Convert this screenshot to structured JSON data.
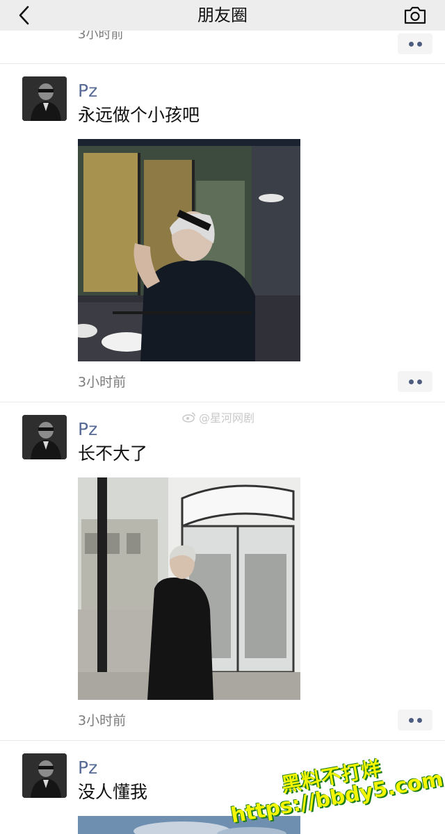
{
  "nav": {
    "title": "朋友圈",
    "back_icon": "chevron-left-icon",
    "camera_icon": "camera-icon"
  },
  "previous_post": {
    "time": "3小时前"
  },
  "posts": [
    {
      "name": "Pz",
      "text": "永远做个小孩吧",
      "time": "3小时前",
      "photo": "man with silver hair sitting at outdoor restaurant table at night"
    },
    {
      "name": "Pz",
      "text": "长不大了",
      "time": "3小时前",
      "photo": "man in black coat standing near revolving glass door"
    },
    {
      "name": "Pz",
      "text": "没人懂我"
    }
  ],
  "watermarks": {
    "weibo": "@星河网剧",
    "overlay_line1": "黑料不打烊",
    "overlay_line2": "https://bbdy5.com"
  },
  "colors": {
    "nickname": "#576b95",
    "navbar_bg": "#ededed",
    "time_text": "#7b7b7b",
    "overlay_text": "#f4f500"
  }
}
